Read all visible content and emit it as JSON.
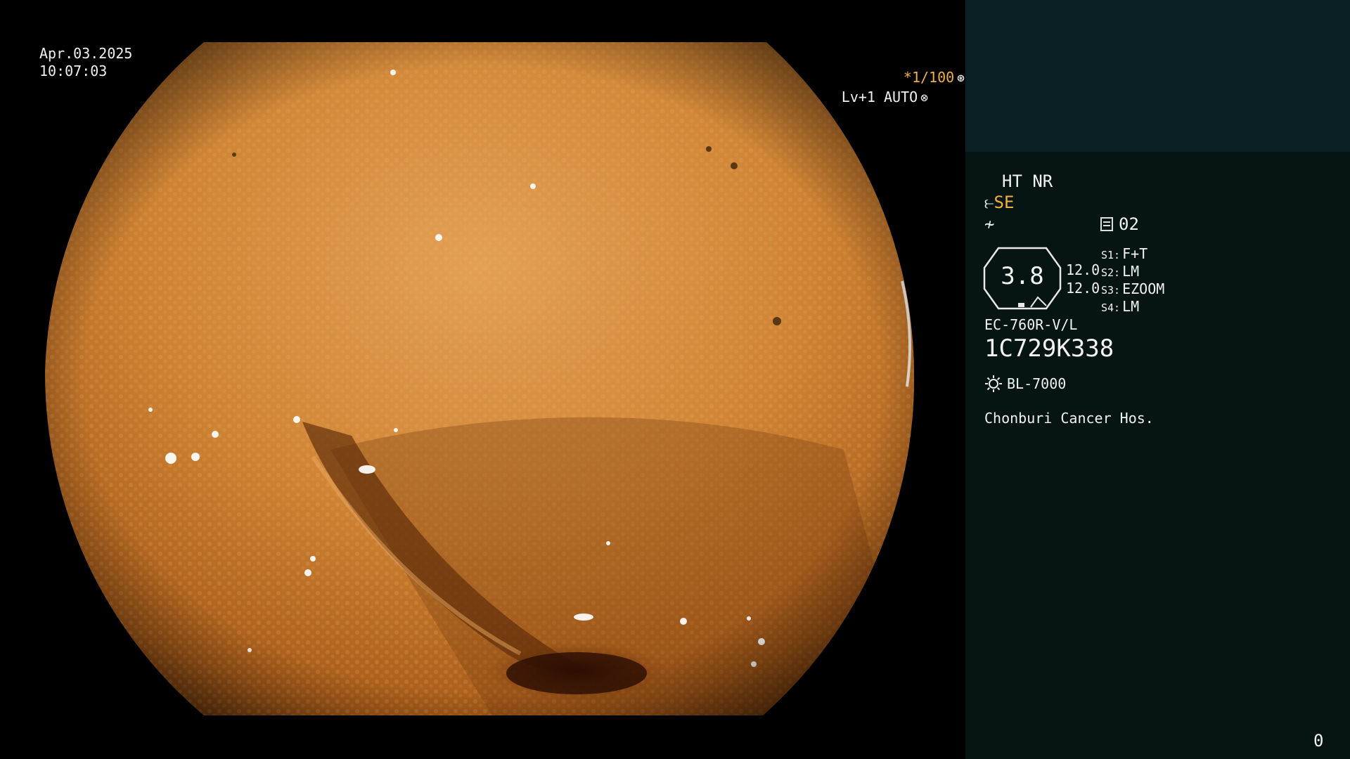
{
  "capture": {
    "date": "Apr.03.2025",
    "time": "10:07:03",
    "shutter": "*1/100",
    "shutter_icon": "shutter-icon",
    "level": "Lv+1 AUTO",
    "level_icon": "iris-icon"
  },
  "processor": {
    "modes": "HT NR",
    "enhancement": "SE",
    "enhancement_icon": "enhancement-icon",
    "noise_icon": "noise-icon",
    "memory_icon": "memory-icon",
    "memory_slot": "02",
    "zoom": "3.8",
    "values": [
      "12.0",
      "12.0"
    ],
    "switches": [
      {
        "key": "S1:",
        "value": "F+T"
      },
      {
        "key": "S2:",
        "value": "LM"
      },
      {
        "key": "S3:",
        "value": "EZOOM"
      },
      {
        "key": "S4:",
        "value": "LM"
      }
    ]
  },
  "scope": {
    "model": "EC-760R-V/L",
    "serial": "1C729K338",
    "light_source_icon": "light-source-icon",
    "light_source": "BL-7000"
  },
  "site": {
    "hospital": "Chonburi Cancer Hos."
  },
  "counter": "0",
  "colors": {
    "mucosa": "#c8782a",
    "highlight_text": "#f0b040",
    "panel": "#071414",
    "panel_top": "#0a2024"
  }
}
